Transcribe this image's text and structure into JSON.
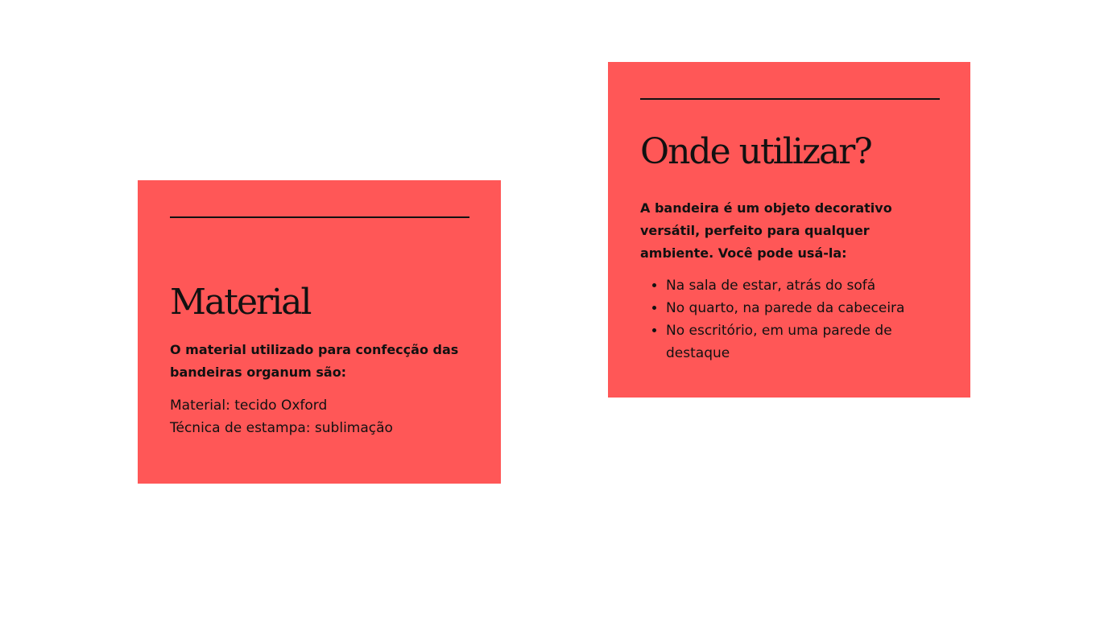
{
  "theme": {
    "card_color": "#ff5757",
    "text_color": "#111111",
    "background": "#ffffff"
  },
  "material_card": {
    "title": "Material",
    "lead": "O material utilizado para confecção das bandeiras organum são:",
    "lines": [
      "Material: tecido Oxford",
      "Técnica de estampa: sublimação"
    ]
  },
  "onde_card": {
    "title": "Onde utilizar?",
    "lead": "A bandeira é um objeto decorativo versátil, perfeito para qualquer ambiente. Você pode usá-la:",
    "items": [
      "Na sala de estar, atrás do sofá",
      "No quarto, na parede da cabeceira",
      "No escritório, em uma parede de destaque"
    ]
  }
}
